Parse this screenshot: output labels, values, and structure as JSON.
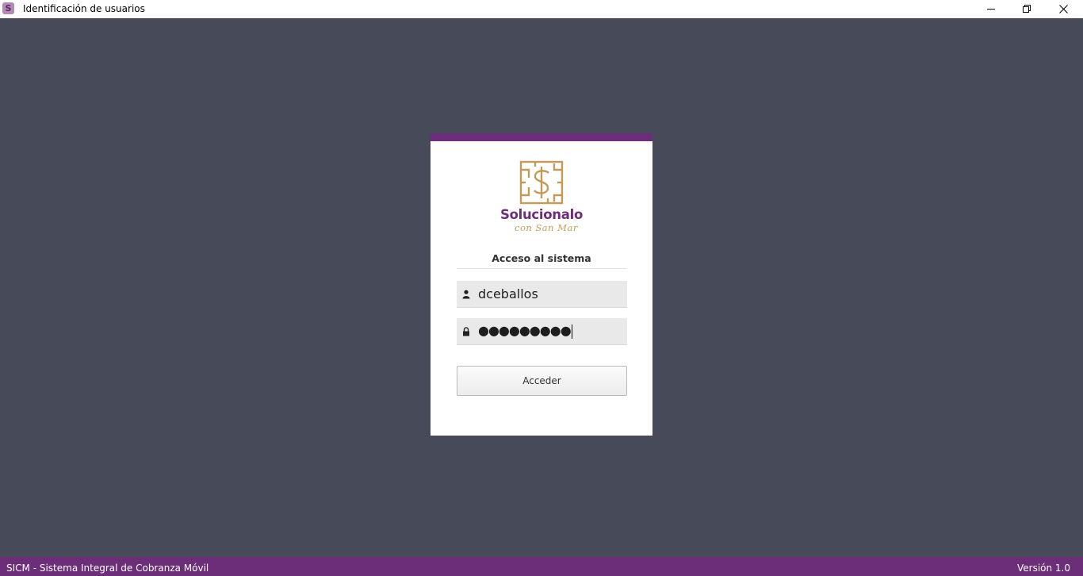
{
  "window": {
    "title": "Identificación de usuarios",
    "app_icon_glyph": "S",
    "controls": {
      "minimize_icon": "minimize-icon",
      "maximize_icon": "restore-icon",
      "close_icon": "close-icon"
    }
  },
  "colors": {
    "background": "#474a58",
    "brand_purple": "#6c2e79",
    "brand_gold": "#c29b5a",
    "card": "#ffffff",
    "field_bg": "#e9e9e9"
  },
  "login": {
    "brand_name": "Solucionalo",
    "brand_tagline": "con San Mar",
    "section_title": "Acceso al sistema",
    "username": {
      "icon": "user-icon",
      "value": "dceballos"
    },
    "password": {
      "icon": "lock-icon",
      "masked_value": "●●●●●●●●●"
    },
    "submit_label": "Acceder"
  },
  "statusbar": {
    "app_name": "SICM - Sistema Integral de Cobranza Móvil",
    "version": "Versión 1.0"
  }
}
